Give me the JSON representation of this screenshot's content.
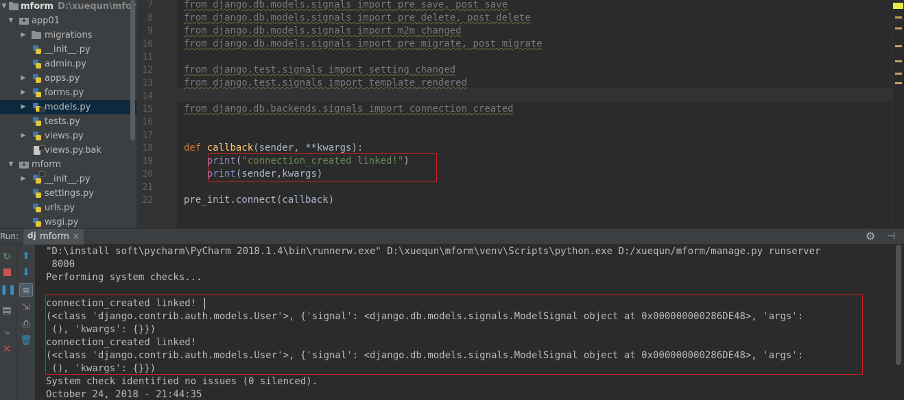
{
  "project": {
    "root_name": "mform",
    "root_path": "D:\\xuequn\\mform",
    "items": [
      {
        "label": "app01",
        "icon": "package-icon",
        "expanded": true
      },
      {
        "label": "migrations",
        "icon": "folder-icon",
        "expanded": false
      },
      {
        "label": "__init__.py",
        "icon": "python-file-icon"
      },
      {
        "label": "admin.py",
        "icon": "python-file-icon"
      },
      {
        "label": "apps.py",
        "icon": "python-file-icon",
        "expanded": false
      },
      {
        "label": "forms.py",
        "icon": "python-file-icon",
        "expanded": false
      },
      {
        "label": "models.py",
        "icon": "python-file-icon",
        "expanded": false,
        "selected": true
      },
      {
        "label": "tests.py",
        "icon": "python-file-icon"
      },
      {
        "label": "views.py",
        "icon": "python-file-icon",
        "expanded": false
      },
      {
        "label": "views.py.bak",
        "icon": "text-file-icon"
      },
      {
        "label": "mform",
        "icon": "package-icon",
        "expanded": true
      },
      {
        "label": "__init__.py",
        "icon": "python-file-icon",
        "expanded": false
      },
      {
        "label": "settings.py",
        "icon": "python-file-icon"
      },
      {
        "label": "urls.py",
        "icon": "python-file-icon"
      },
      {
        "label": "wsgi.py",
        "icon": "python-file-icon"
      }
    ]
  },
  "editor": {
    "line_numbers": [
      "7",
      "8",
      "9",
      "10",
      "11",
      "12",
      "13",
      "14",
      "15",
      "16",
      "17",
      "18",
      "19",
      "20",
      "21",
      "22"
    ],
    "lines": {
      "l7_a": "from",
      "l7_b": " django.db.models.signals ",
      "l7_c": "import",
      "l7_d": " pre_save, post_save",
      "l8_a": "from",
      "l8_b": " django.db.models.signals ",
      "l8_c": "import",
      "l8_d": " pre_delete, post_delete",
      "l9_a": "from",
      "l9_b": " django.db.models.signals ",
      "l9_c": "import",
      "l9_d": " m2m_changed",
      "l10_a": "from",
      "l10_b": " django.db.models.signals ",
      "l10_c": "import",
      "l10_d": " pre_migrate, post_migrate",
      "l12_a": "from",
      "l12_b": " django.test.signals ",
      "l12_c": "import",
      "l12_d": " setting_changed",
      "l13_a": "from",
      "l13_b": " django.test.signals ",
      "l13_c": "import",
      "l13_d": " template_rendered",
      "l15_a": "from",
      "l15_b": " django.db.backends.signals ",
      "l15_c": "import",
      "l15_d": " connection_created",
      "l18_kw": "def",
      "l18_fn": " callback",
      "l18_rest": "(sender, **kwargs):",
      "l19_indent": "    ",
      "l19_fn": "print",
      "l19_open": "(",
      "l19_str": "\"connection_created linked!\"",
      "l19_close": ")",
      "l20_indent": "    ",
      "l20_fn": "print",
      "l20_rest": "(sender,kwargs)",
      "l22": "pre_init.connect(callback)"
    }
  },
  "run": {
    "label": "Run:",
    "tab_icon": "dj",
    "tab_label": "mform",
    "close": "×",
    "gear": "⚙",
    "hide": "⊣",
    "console": [
      "\"D:\\install soft\\pycharm\\PyCharm 2018.1.4\\bin\\runnerw.exe\" D:\\xuequn\\mform\\venv\\Scripts\\python.exe D:/xuequn/mform/manage.py runserver",
      " 8000",
      "Performing system checks...",
      "",
      "connection_created linked!",
      "(<class 'django.contrib.auth.models.User'>, {'signal': <django.db.models.signals.ModelSignal object at 0x000000000286DE48>, 'args':",
      " (), 'kwargs': {}})",
      "connection_created linked!",
      "(<class 'django.contrib.auth.models.User'>, {'signal': <django.db.models.signals.ModelSignal object at 0x000000000286DE48>, 'args':",
      " (), 'kwargs': {}})",
      "System check identified no issues (0 silenced).",
      "October 24, 2018 - 21:44:35"
    ]
  },
  "colors": {
    "highlight_box": "#d32020",
    "keyword": "#cc7832",
    "function": "#ffc66d",
    "builtin": "#8888c6",
    "string": "#6a8759"
  }
}
